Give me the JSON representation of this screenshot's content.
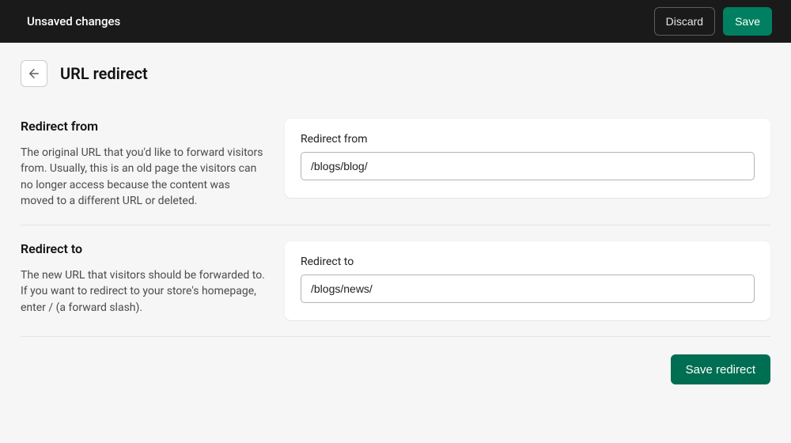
{
  "topbar": {
    "status": "Unsaved changes",
    "discard": "Discard",
    "save": "Save"
  },
  "header": {
    "title": "URL redirect"
  },
  "sections": {
    "redirect_from": {
      "heading": "Redirect from",
      "description": "The original URL that you'd like to forward visitors from. Usually, this is an old page the visitors can no longer access because the content was moved to a different URL or deleted.",
      "field_label": "Redirect from",
      "field_value": "/blogs/blog/"
    },
    "redirect_to": {
      "heading": "Redirect to",
      "description": "The new URL that visitors should be forwarded to. If you want to redirect to your store's homepage, enter / (a forward slash).",
      "field_label": "Redirect to",
      "field_value": "/blogs/news/"
    }
  },
  "footer": {
    "save_redirect": "Save redirect"
  }
}
